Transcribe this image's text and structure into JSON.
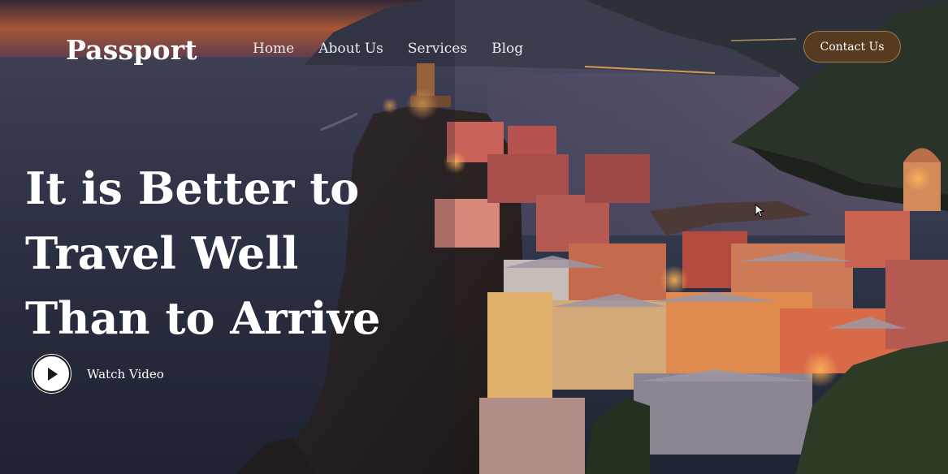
{
  "brand": {
    "name": "Passport"
  },
  "nav": {
    "items": [
      {
        "label": "Home"
      },
      {
        "label": "About Us"
      },
      {
        "label": "Services"
      },
      {
        "label": "Blog"
      }
    ],
    "cta_label": "Contact Us"
  },
  "hero": {
    "headline_lines": [
      "It is Better to",
      "Travel Well",
      "Than to Arrive"
    ],
    "watch_video_label": "Watch Video"
  },
  "colors": {
    "cta_background": "#5c3c1e",
    "text": "#ffffff",
    "sea": "#2f3548",
    "sunset": "#e0733a"
  }
}
